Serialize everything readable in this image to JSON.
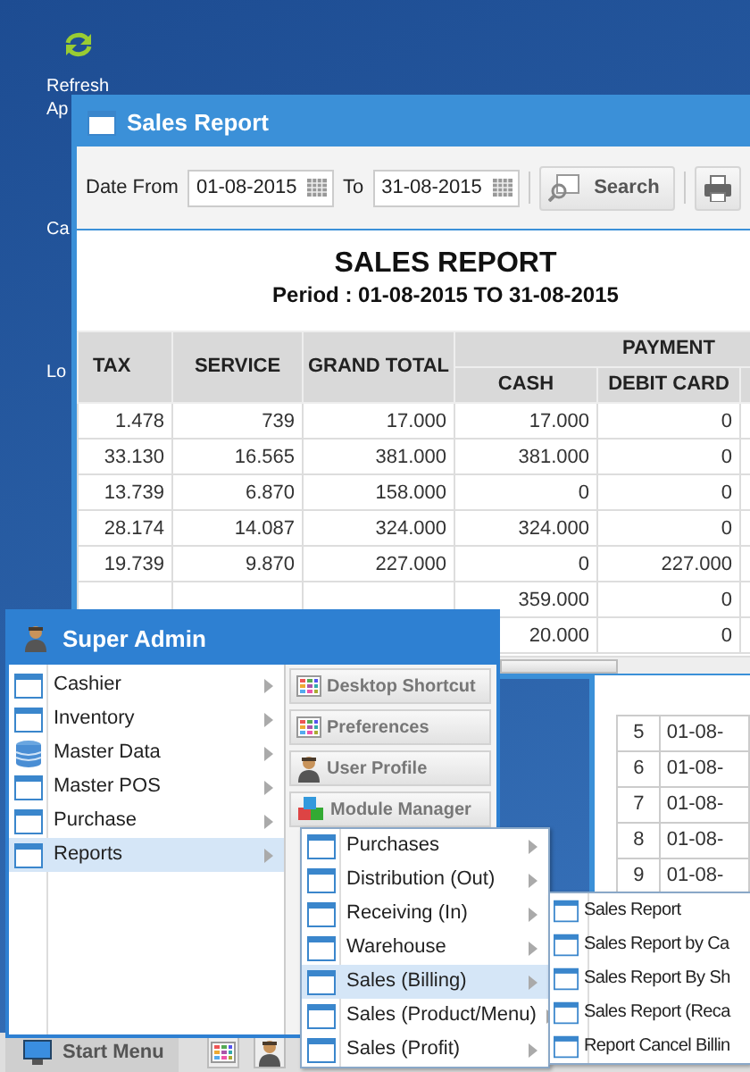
{
  "desktop_icons": [
    {
      "lines": [
        "Refresh",
        "Ap"
      ],
      "kind": "refresh"
    },
    {
      "lines": [
        "Ca"
      ],
      "kind": "hidden"
    },
    {
      "lines": [
        "Lo"
      ],
      "kind": "hidden"
    }
  ],
  "report_window": {
    "title": "Sales Report",
    "toolbar": {
      "date_from_label": "Date From",
      "date_from": "01-08-2015",
      "to_label": "To",
      "date_to": "31-08-2015",
      "search_button": "Search"
    },
    "report": {
      "title": "SALES REPORT",
      "period": "Period : 01-08-2015 TO 31-08-2015",
      "columns": [
        {
          "label": "TAX"
        },
        {
          "label": "SERVICE"
        },
        {
          "label": "GRAND TOTAL"
        }
      ],
      "group_header": "PAYMENT",
      "group_columns": [
        {
          "label": "CASH"
        },
        {
          "label": "DEBIT CARD"
        }
      ],
      "rows": [
        {
          "tax": "1.478",
          "service": "739",
          "grand_total": "17.000",
          "cash": "17.000",
          "debit_card": "0"
        },
        {
          "tax": "33.130",
          "service": "16.565",
          "grand_total": "381.000",
          "cash": "381.000",
          "debit_card": "0"
        },
        {
          "tax": "13.739",
          "service": "6.870",
          "grand_total": "158.000",
          "cash": "0",
          "debit_card": "0"
        },
        {
          "tax": "28.174",
          "service": "14.087",
          "grand_total": "324.000",
          "cash": "324.000",
          "debit_card": "0"
        },
        {
          "tax": "19.739",
          "service": "9.870",
          "grand_total": "227.000",
          "cash": "0",
          "debit_card": "227.000"
        },
        {
          "cash": "359.000",
          "debit_card": "0"
        },
        {
          "cash": "20.000",
          "debit_card": "0"
        }
      ]
    }
  },
  "back_window": {
    "rows": [
      {
        "no": "5",
        "date": "01-08-"
      },
      {
        "no": "6",
        "date": "01-08-"
      },
      {
        "no": "7",
        "date": "01-08-"
      },
      {
        "no": "8",
        "date": "01-08-"
      },
      {
        "no": "9",
        "date": "01-08-"
      }
    ]
  },
  "start_menu": {
    "user": "Super Admin",
    "items": [
      {
        "label": "Cashier",
        "kind": "window",
        "selected": false
      },
      {
        "label": "Inventory",
        "kind": "window",
        "selected": false
      },
      {
        "label": "Master Data",
        "kind": "database",
        "selected": false
      },
      {
        "label": "Master POS",
        "kind": "window",
        "selected": false
      },
      {
        "label": "Purchase",
        "kind": "window",
        "selected": false
      },
      {
        "label": "Reports",
        "kind": "window",
        "selected": true
      }
    ],
    "shortcuts": [
      {
        "label": "Desktop Shortcut",
        "kind": "grid"
      },
      {
        "label": "Preferences",
        "kind": "grid"
      },
      {
        "label": "User Profile",
        "kind": "user"
      },
      {
        "label": "Module Manager",
        "kind": "module"
      }
    ],
    "submenu": [
      {
        "label": "Purchases",
        "selected": false
      },
      {
        "label": "Distribution (Out)",
        "selected": false
      },
      {
        "label": "Receiving (In)",
        "selected": false
      },
      {
        "label": "Warehouse",
        "selected": false
      },
      {
        "label": "Sales (Billing)",
        "selected": true
      },
      {
        "label": "Sales (Product/Menu)",
        "selected": false
      },
      {
        "label": "Sales (Profit)",
        "selected": false
      }
    ],
    "submenu_2": [
      {
        "label": "Sales Report"
      },
      {
        "label": "Sales Report by Ca"
      },
      {
        "label": "Sales Report By Sh"
      },
      {
        "label": "Sales Report (Reca"
      },
      {
        "label": "Report Cancel Billin"
      }
    ]
  },
  "taskbar": {
    "start_button": "Start Menu",
    "quick_icons": [
      {
        "kind": "grid"
      },
      {
        "kind": "user"
      }
    ]
  }
}
